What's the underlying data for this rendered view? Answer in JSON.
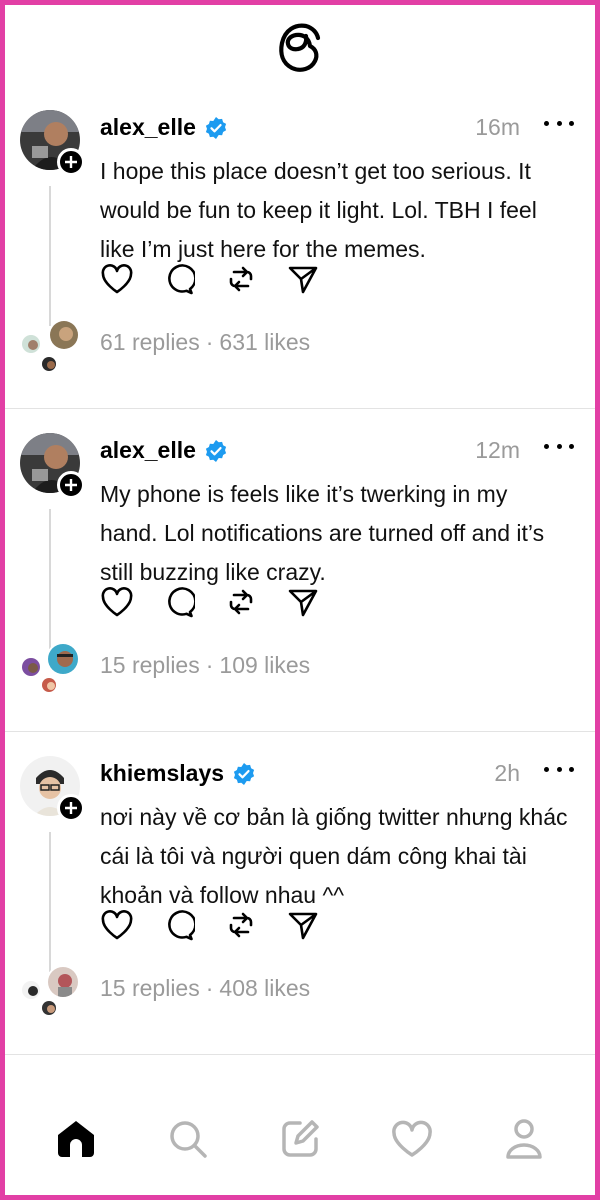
{
  "app": {
    "logo_icon": "threads-logo-icon"
  },
  "colors": {
    "border": "#e23fa5",
    "verified": "#1d9bf0",
    "muted": "#9a9a9a"
  },
  "posts": [
    {
      "username": "alex_elle",
      "verified": true,
      "time": "16m",
      "text": "I hope this place doesn’t get too serious. It would be fun to keep it light. Lol. TBH I feel like I’m just here for the memes.",
      "replies": "61 replies",
      "separator": "·",
      "likes": "631 likes"
    },
    {
      "username": "alex_elle",
      "verified": true,
      "time": "12m",
      "text": "My phone is feels like it’s twerking in my hand. Lol notifications are turned off and it’s still buzzing like crazy.",
      "replies": "15 replies",
      "separator": "·",
      "likes": "109 likes"
    },
    {
      "username": "khiemslays",
      "verified": true,
      "time": "2h",
      "text": "nơi này về cơ bản là giống twitter nhưng khác cái là tôi và người quen dám công khai tài khoản và follow nhau ^^",
      "replies": "15 replies",
      "separator": "·",
      "likes": "408 likes"
    }
  ],
  "nav": {
    "tabs": [
      "home-icon",
      "search-icon",
      "compose-icon",
      "activity-heart-icon",
      "profile-icon"
    ],
    "active": "home-icon"
  }
}
